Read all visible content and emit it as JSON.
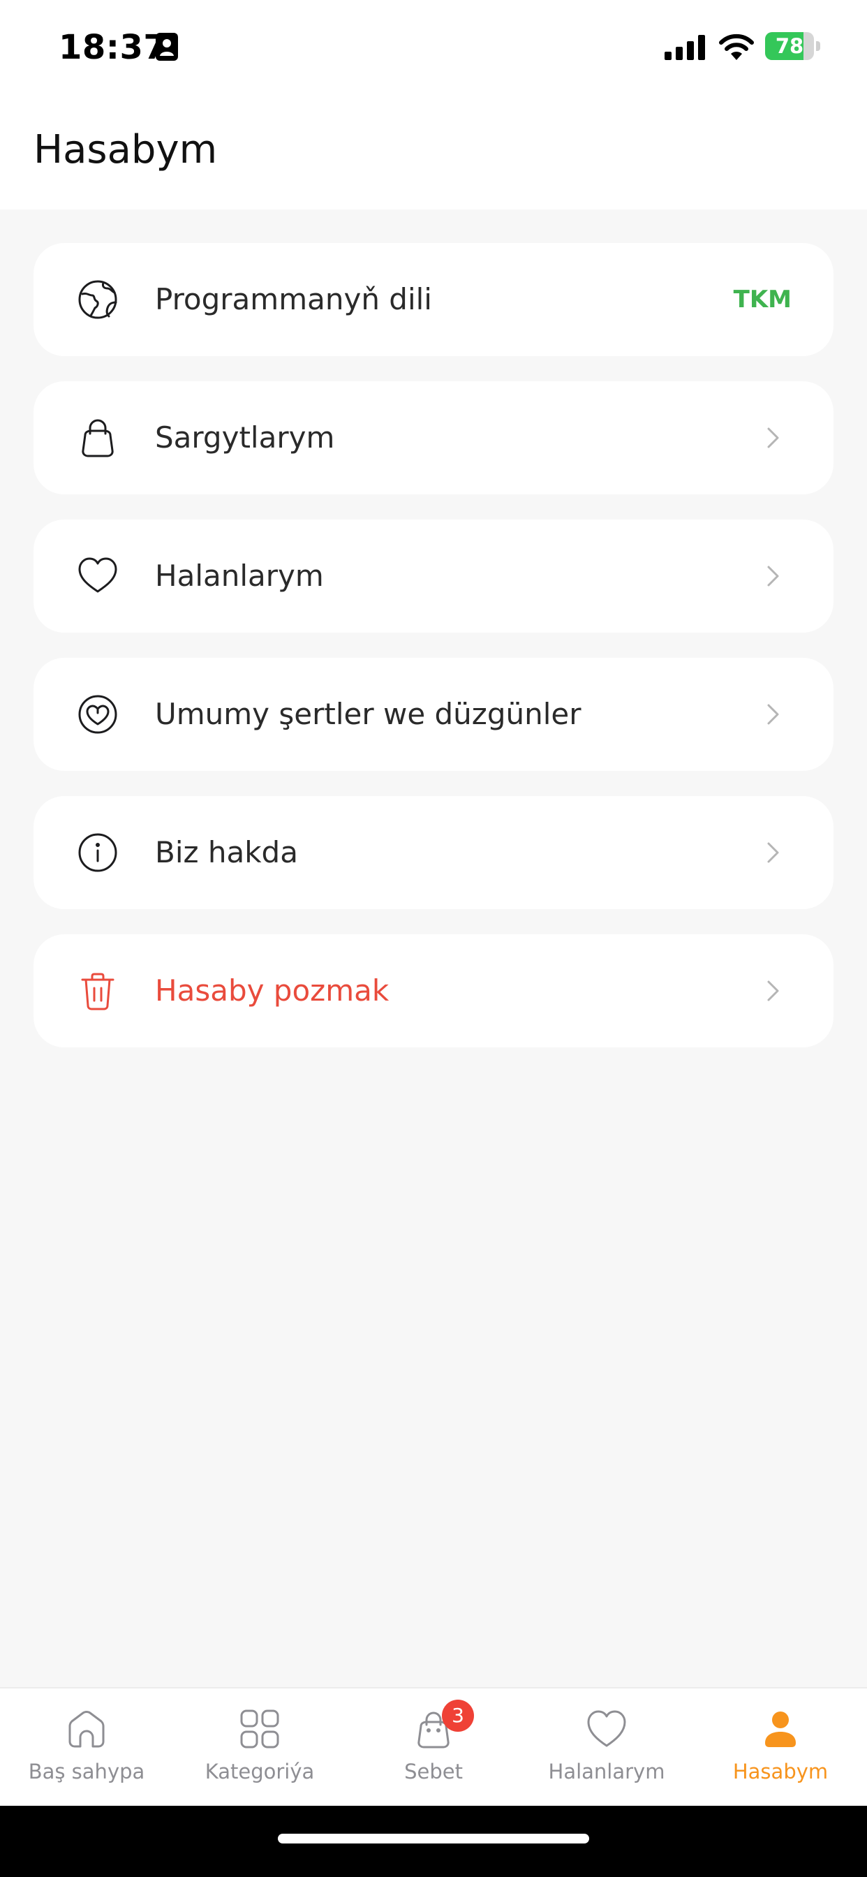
{
  "status_bar": {
    "time": "18:37",
    "battery_percent": "78",
    "battery_level": 0.78,
    "battery_color": "#34c759"
  },
  "header": {
    "title": "Hasabym"
  },
  "menu": {
    "items": [
      {
        "label": "Programmanyň dili",
        "value": "TKM",
        "icon": "globe-icon"
      },
      {
        "label": "Sargytlarym",
        "icon": "shopping-bag-icon"
      },
      {
        "label": "Halanlarym",
        "icon": "heart-icon"
      },
      {
        "label": "Umumy şertler we düzgünler",
        "icon": "terms-heart-icon"
      },
      {
        "label": "Biz hakda",
        "icon": "info-icon"
      },
      {
        "label": "Hasaby pozmak",
        "icon": "trash-icon",
        "color": "#e94b3c"
      }
    ]
  },
  "tab_bar": {
    "active_color": "#f7941d",
    "tabs": [
      {
        "label": "Baş sahypa",
        "icon": "home-icon"
      },
      {
        "label": "Kategoriýa",
        "icon": "grid-icon"
      },
      {
        "label": "Sebet",
        "icon": "cart-bag-icon",
        "badge": "3"
      },
      {
        "label": "Halanlarym",
        "icon": "heart-icon"
      },
      {
        "label": "Hasabym",
        "icon": "user-icon",
        "active": true
      }
    ]
  }
}
